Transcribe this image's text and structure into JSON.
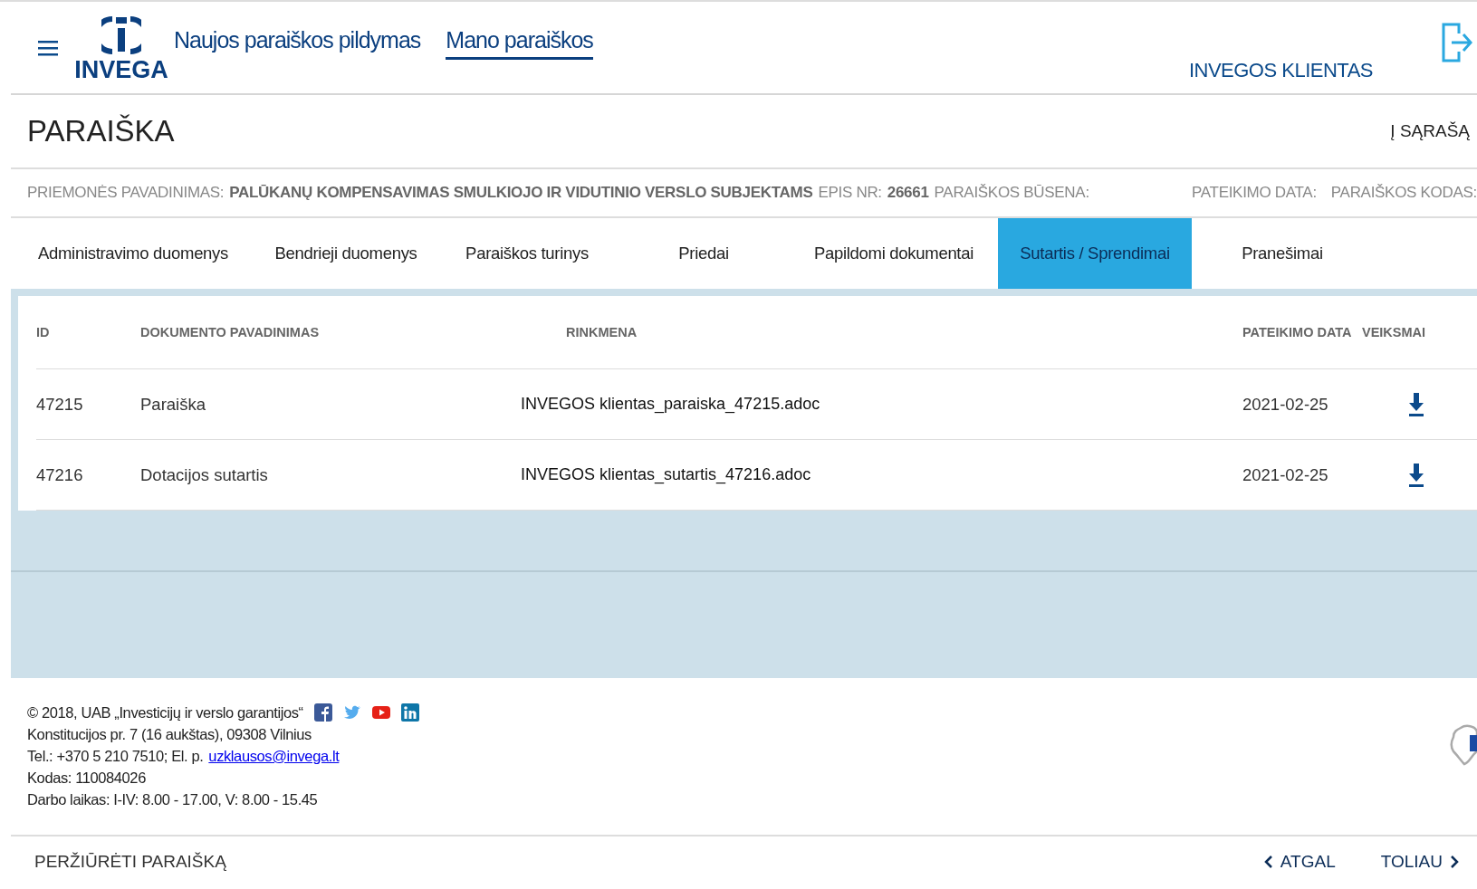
{
  "header": {
    "logo_text": "INVEGA",
    "nav": [
      {
        "label": "Naujos paraiškos pildymas",
        "selected": false
      },
      {
        "label": "Mano paraiškos",
        "selected": true
      }
    ],
    "user": "INVEGOS KLIENTAS"
  },
  "page": {
    "title": "PARAIŠKA",
    "back_link": "Į SĄRAŠĄ"
  },
  "meta": {
    "measure_label": "PRIEMONĖS PAVADINIMAS:",
    "measure_value": "PALŪKANŲ KOMPENSAVIMAS SMULKIOJO IR VIDUTINIO VERSLO SUBJEKTAMS",
    "epis_label": "EPIS NR:",
    "epis_value": "26661",
    "status_label": "PARAIŠKOS BŪSENA:",
    "date_label": "PATEIKIMO DATA:",
    "code_label": "PARAIŠKOS KODAS:"
  },
  "tabs": [
    {
      "label": "Administravimo duomenys",
      "selected": false
    },
    {
      "label": "Bendrieji duomenys",
      "selected": false
    },
    {
      "label": "Paraiškos turinys",
      "selected": false
    },
    {
      "label": "Priedai",
      "selected": false
    },
    {
      "label": "Papildomi dokumentai",
      "selected": false
    },
    {
      "label": "Sutartis / Sprendimai",
      "selected": true
    },
    {
      "label": "Pranešimai",
      "selected": false
    }
  ],
  "table": {
    "columns": [
      "ID",
      "DOKUMENTO PAVADINIMAS",
      "RINKMENA",
      "PATEIKIMO DATA",
      "VEIKSMAI"
    ],
    "rows": [
      {
        "id": "47215",
        "name": "Paraiška",
        "file": "INVEGOS klientas_paraiska_47215.adoc",
        "date": "2021-02-25"
      },
      {
        "id": "47216",
        "name": "Dotacijos sutartis",
        "file": "INVEGOS klientas_sutartis_47216.adoc",
        "date": "2021-02-25"
      }
    ]
  },
  "footer": {
    "copyright": "© 2018, UAB „Investicijų ir verslo garantijos“",
    "address": "Konstitucijos pr. 7 (16 aukštas), 09308 Vilnius",
    "phone": "Tel.: +370 5 210 7510; El. p.",
    "email": "uzklausos@invega.lt",
    "code": "Kodas: 110084026",
    "hours": "Darbo laikas: I-IV: 8.00 - 17.00, V: 8.00 - 15.45"
  },
  "bottom_bar": {
    "view_link": "PERŽIŪRĖTI PARAIŠKĄ",
    "back": "ATGAL",
    "next": "TOLIAU"
  }
}
